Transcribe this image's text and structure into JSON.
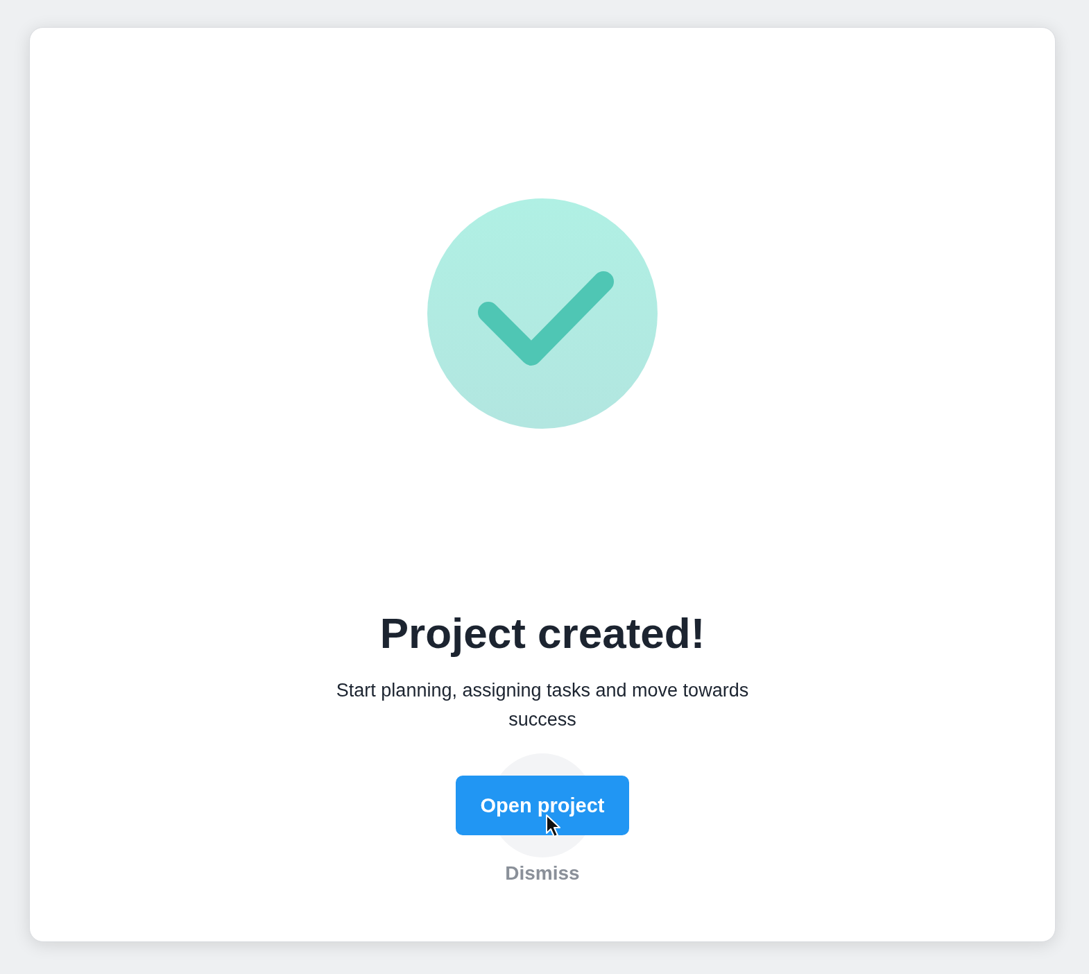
{
  "dialog": {
    "title": "Project created!",
    "message": "Start planning, assigning tasks and move towards success",
    "buttons": [
      {
        "label": "Open project",
        "kind": "primary"
      },
      {
        "label": "Dismiss",
        "kind": "link"
      }
    ]
  }
}
